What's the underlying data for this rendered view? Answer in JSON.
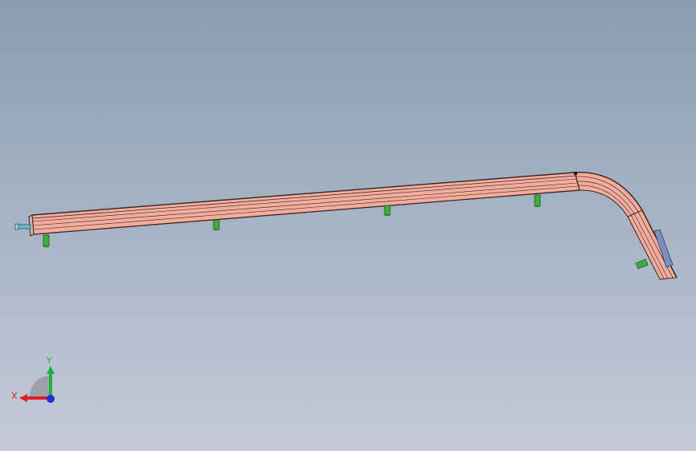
{
  "viewport": {
    "background_top": "#8a9cb1",
    "background_bottom": "#c4cad7"
  },
  "model": {
    "rail_color": "#f2ad9c",
    "rail_edge_color": "#3a2622",
    "pin_color": "#3fae3f",
    "connector_color": "#6fb6c8"
  },
  "triad": {
    "x_label": "X",
    "y_label": "Y",
    "x_color": "#e02020",
    "y_color": "#20b040",
    "z_color": "#2030d0"
  }
}
